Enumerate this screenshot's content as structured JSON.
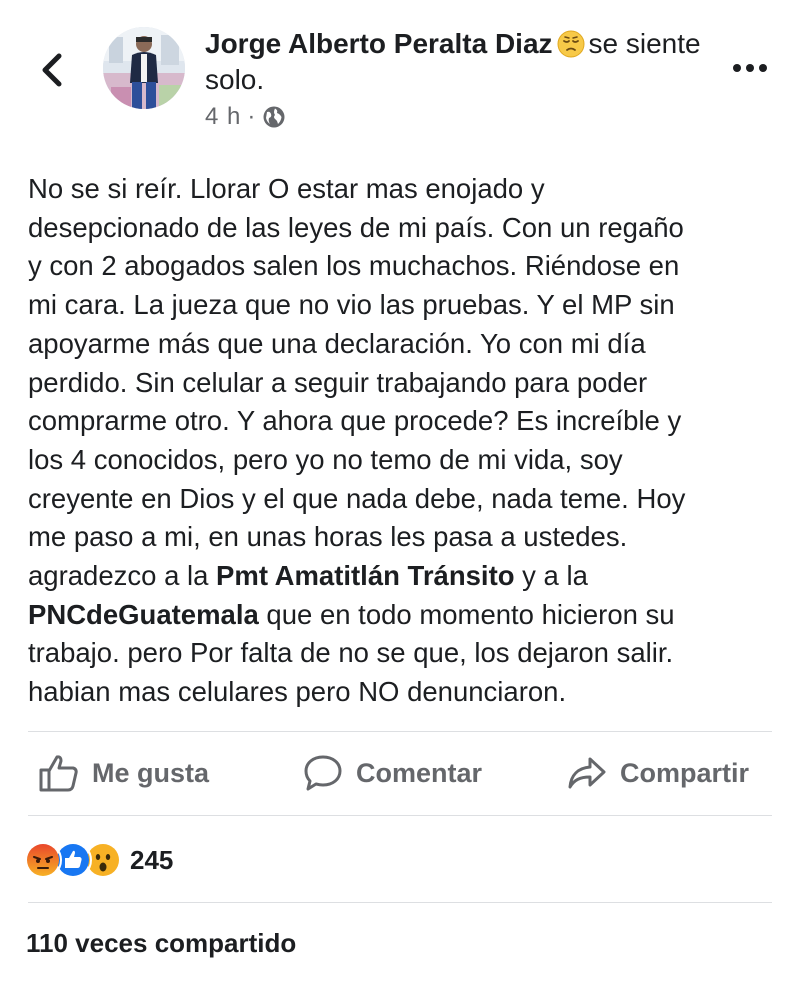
{
  "post": {
    "author": "Jorge Alberto Peralta Diaz",
    "feeling": "se siente solo.",
    "feeling_emoji": "pensive-face",
    "time": "4 h",
    "separator": "·",
    "privacy_icon": "globe-icon",
    "body": [
      "No se si reír. Llorar O estar mas enojado y",
      "desepcionado de las leyes de mi país.  Con un regaño",
      "y con 2 abogados salen los muchachos.  Riéndose en",
      "mi cara. La jueza que no vio las pruebas. Y el MP sin",
      "apoyarme más que una declaración.  Yo con mi día",
      "perdido. Sin celular a seguir trabajando para poder",
      "comprarme otro.  Y ahora que procede?  Es increíble y",
      "los 4 conocidos, pero yo no temo de mi vida, soy",
      "creyente en Dios y el que nada debe, nada teme. Hoy",
      "me paso a mi, en unas horas les pasa a ustedes."
    ],
    "line11": {
      "pre": "agradezco a la ",
      "mention": "Pmt Amatitlán Tránsito",
      "post": " y a la"
    },
    "line12": {
      "mention": "PNCdeGuatemala",
      "post": " que en todo momento hicieron su"
    },
    "tail": [
      "trabajo. pero Por falta de no se que, los dejaron salir.",
      "habian mas celulares pero NO denunciaron."
    ]
  },
  "actions": {
    "like": "Me gusta",
    "comment": "Comentar",
    "share": "Compartir"
  },
  "reactions": {
    "icons": [
      "angry-reaction",
      "like-reaction",
      "wow-reaction"
    ],
    "count": "245"
  },
  "shares": "110 veces compartido",
  "colors": {
    "text": "#1c1e21",
    "secondary": "#65676b",
    "like_blue": "#1877f2",
    "angry": "#e9710f",
    "wow": "#f7b125"
  }
}
